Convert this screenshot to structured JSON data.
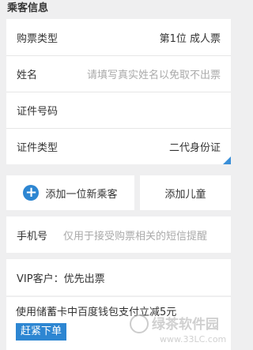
{
  "section_title": "乘客信息",
  "passenger_rows": [
    {
      "label": "购票类型",
      "value": "第1位  成人票"
    },
    {
      "label": "姓名",
      "placeholder": "请填写真实姓名以免取不出票"
    },
    {
      "label": "证件号码"
    },
    {
      "label": "证件类型",
      "value": "二代身份证"
    }
  ],
  "add_passenger_label": "添加一位新乘客",
  "add_child_label": "添加儿童",
  "phone": {
    "label": "手机号",
    "placeholder": "仅用于接受购票相关的短信提醒"
  },
  "vip_text": "VIP客户：优先出票",
  "promo": {
    "text": "使用储蓄卡中百度钱包支付立减5元",
    "button_label": "赶紧下单"
  },
  "watermark": {
    "line1": "绿茶软件园",
    "line2": "www.33LC.com"
  },
  "colors": {
    "accent": "#2d86d2",
    "background": "#efeff0"
  }
}
